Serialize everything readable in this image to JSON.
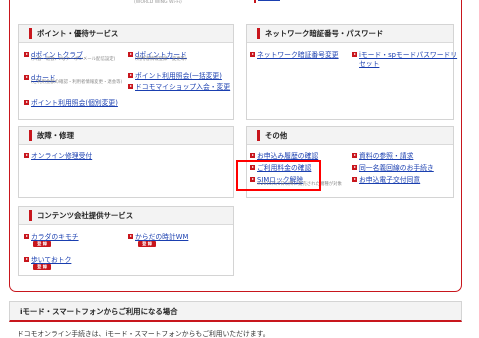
{
  "top": {
    "wing_note": "(WORLD WING Wi-Fi)"
  },
  "points": {
    "title": "ポイント・優待サービス",
    "left": [
      {
        "label": "dポイントクラブ",
        "note": "(入会・退会、Myクーポンメール配信設定)"
      },
      {
        "label": "dカード",
        "note": "(ご利用金額の確認・利用者情報変更・退会等)"
      },
      {
        "label": "ポイント利用照会(個別変更)"
      }
    ],
    "right": [
      {
        "label": "dポイントカード",
        "note": "(利用者情報登録・変更等)"
      },
      {
        "label": "ポイント利用照会(一括変更)"
      },
      {
        "label": "ドコモマイショップ入会・変更"
      }
    ]
  },
  "network": {
    "title": "ネットワーク暗証番号・パスワード",
    "left": [
      {
        "label": "ネットワーク暗証番号変更"
      }
    ],
    "right": [
      {
        "label": "iモード・spモードパスワードリセット",
        "line1": "iモード・spモードパスワードリ",
        "line2": "セット"
      }
    ]
  },
  "repair": {
    "title": "故障・修理",
    "items": [
      {
        "label": "オンライン修理受付"
      }
    ]
  },
  "other": {
    "title": "その他",
    "left": [
      {
        "label": "お申込み履歴の確認"
      },
      {
        "label": "ご利用料金の確認",
        "label_full": "ご利用料金の確認"
      },
      {
        "label": "SIMロック解除",
        "note": "※2015/5/1日以降に発売された機種が対象"
      }
    ],
    "right": [
      {
        "label": "資料の参照・請求"
      },
      {
        "label": "同一名義回線のお手続き"
      },
      {
        "label": "お申込電子交付同意"
      }
    ]
  },
  "content": {
    "title": "コンテンツ会社提供サービス",
    "items": [
      {
        "label": "カラダのキモチ",
        "button": "登 録"
      },
      {
        "label": "からだの時計WM",
        "button": "登 録"
      },
      {
        "label": "歩いておトク",
        "button": "登 録"
      }
    ]
  },
  "imode_section": {
    "title": "iモード・スマートフォンからご利用になる場合",
    "text": "ドコモオンライン手続きは、iモード・スマートフォンからもご利用いただけます。"
  },
  "colors": {
    "accent": "#c8161d",
    "link": "#1a3fb0",
    "highlight": "#ff0000"
  }
}
